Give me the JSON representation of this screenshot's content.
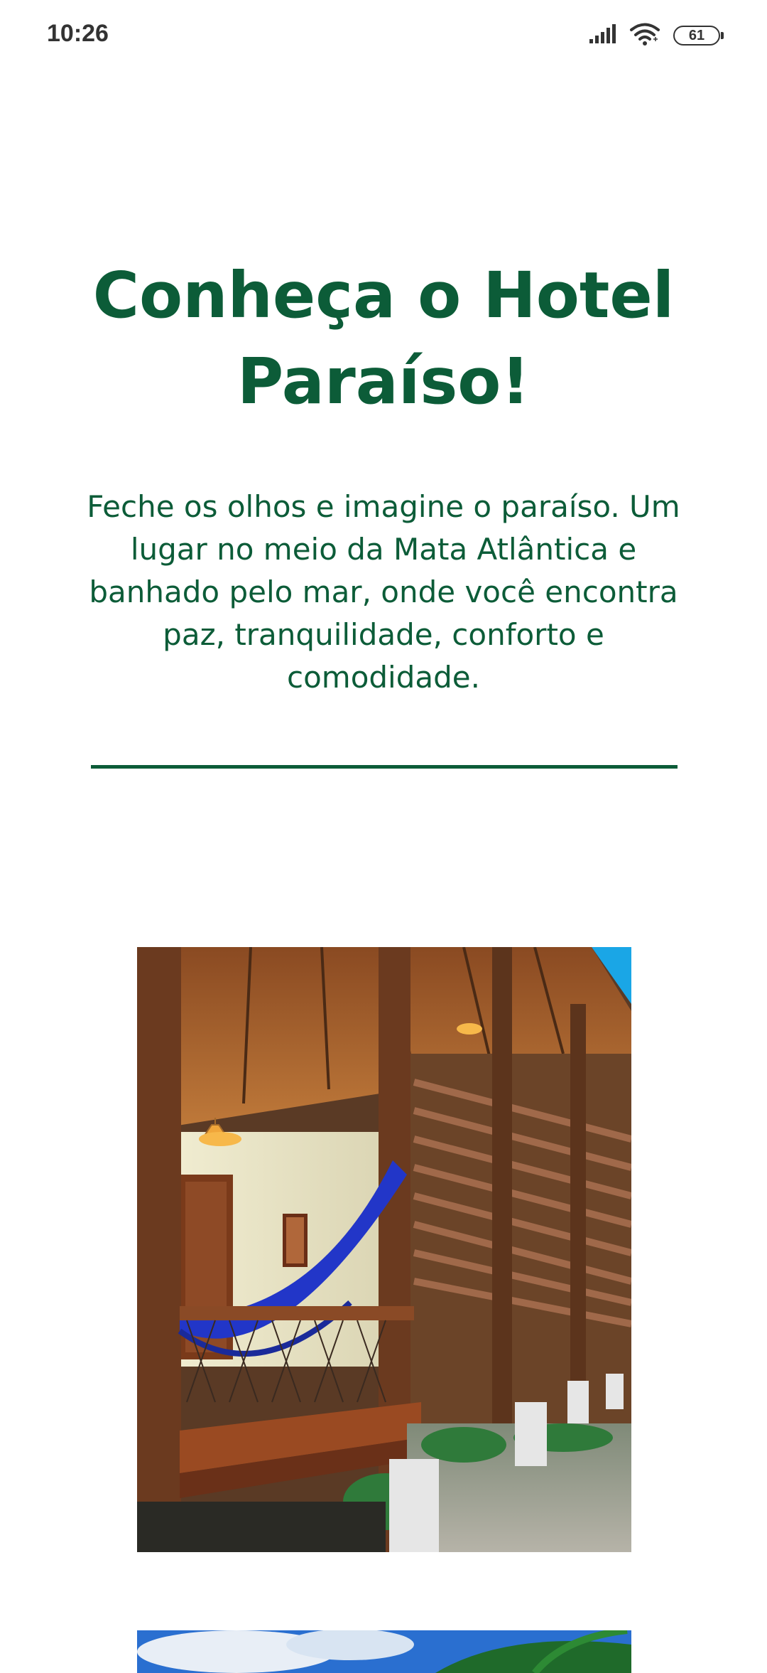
{
  "status_bar": {
    "time": "10:26",
    "battery_level": "61",
    "icons": [
      "signal-icon",
      "wifi-icon",
      "battery-icon"
    ]
  },
  "main": {
    "heading": "Conheça o Hotel Paraíso!",
    "intro": "Feche os olhos e imagine o paraíso. Um lugar no meio da Mata Atlântica e banhado pelo mar, onde você encontra paz, tranquilidade, conforto e comodidade.",
    "photos": [
      {
        "name": "hotel-veranda-photo"
      },
      {
        "name": "beach-palm-photo"
      }
    ]
  },
  "colors": {
    "brand_green": "#0c5c38",
    "status_text": "#333333",
    "background": "#ffffff"
  }
}
